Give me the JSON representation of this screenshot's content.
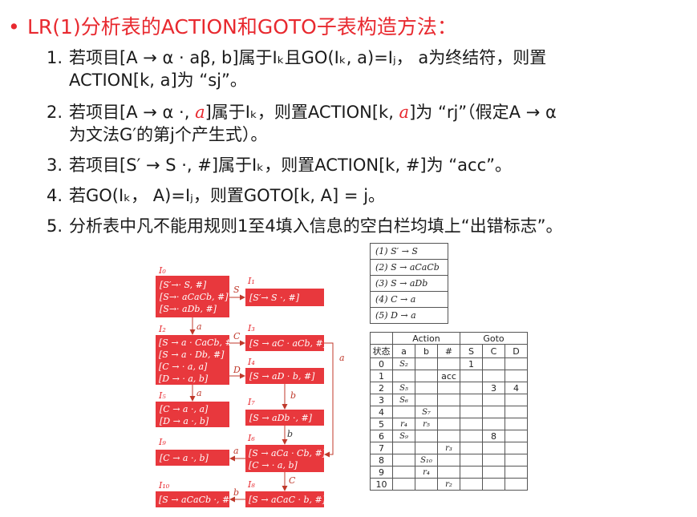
{
  "title": "LR(1)分析表的ACTION和GOTO子表构造方法：",
  "rules": [
    {
      "num": "1.",
      "text": "若项目[A → α · aβ, b]属于Iₖ且GO(Iₖ, a)=Iⱼ，  a为终结符，则置",
      "cont": "ACTION[k, a]为 “sj”。"
    },
    {
      "num": "2.",
      "pre": "若项目[A → α ·, ",
      "red1": "a",
      "mid": "]属于Iₖ，则置ACTION[k, ",
      "red2": "a",
      "post": "]为 “rj”（假定A → α",
      "cont": "为文法G′的第j个产生式）。"
    },
    {
      "num": "3.",
      "text": "若项目[S′ → S ·, #]属于Iₖ，则置ACTION[k, #]为 “acc”。"
    },
    {
      "num": "4.",
      "text": "若GO(Iₖ， A)=Iⱼ，则置GOTO[k, A] = j。"
    },
    {
      "num": "5.",
      "text": "分析表中凡不能用规则1至4填入信息的空白栏均填上“出错标志”。"
    }
  ],
  "states": [
    {
      "label": "I₀",
      "items": [
        "[S′→· S, #]",
        "[S→· aCaCb, #]",
        "[S→· aDb, #]"
      ]
    },
    {
      "label": "I₁",
      "items": [
        "[S′→ S ·, #]"
      ]
    },
    {
      "label": "I₂",
      "items": [
        "[S → a · CaCb, #]",
        "[S → a · Db, #]",
        "[C → · a, a]",
        "[D → · a, b]"
      ]
    },
    {
      "label": "I₃",
      "items": [
        "[S → aC · aCb, #]"
      ]
    },
    {
      "label": "I₄",
      "items": [
        "[S → aD · b, #]"
      ]
    },
    {
      "label": "I₅",
      "items": [
        "[C → a ·, a]",
        "[D → a ·, b]"
      ]
    },
    {
      "label": "I₇",
      "items": [
        "[S → aDb ·, #]"
      ]
    },
    {
      "label": "I₆",
      "items": [
        "[S → aCa · Cb, #]",
        "[C → · a, b]"
      ]
    },
    {
      "label": "I₉",
      "items": [
        "[C → a ·, b]"
      ]
    },
    {
      "label": "I₁₀",
      "items": [
        "[S → aCaCb ·, #]"
      ]
    },
    {
      "label": "I₈",
      "items": [
        "[S → aCaC · b, #]"
      ]
    }
  ],
  "edges": [
    "S",
    "a",
    "C",
    "D",
    "a",
    "b",
    "b",
    "a",
    "a",
    "C",
    "b"
  ],
  "grammar": [
    "(1) S′ → S",
    "(2) S → aCaCb",
    "(3) S → aDb",
    "(4) C → a",
    "(5) D → a"
  ],
  "table": {
    "action_label": "Action",
    "goto_label": "Goto",
    "headers": [
      "状态",
      "a",
      "b",
      "#",
      "S",
      "C",
      "D"
    ],
    "rows": [
      [
        "0",
        "S₂",
        "",
        "",
        "1",
        "",
        ""
      ],
      [
        "1",
        "",
        "",
        "acc",
        "",
        "",
        ""
      ],
      [
        "2",
        "S₅",
        "",
        "",
        "",
        "3",
        "4"
      ],
      [
        "3",
        "S₆",
        "",
        "",
        "",
        "",
        ""
      ],
      [
        "4",
        "",
        "S₇",
        "",
        "",
        "",
        ""
      ],
      [
        "5",
        "r₄",
        "r₅",
        "",
        "",
        "",
        ""
      ],
      [
        "6",
        "S₉",
        "",
        "",
        "",
        "8",
        ""
      ],
      [
        "7",
        "",
        "",
        "r₃",
        "",
        "",
        ""
      ],
      [
        "8",
        "",
        "S₁₀",
        "",
        "",
        "",
        ""
      ],
      [
        "9",
        "",
        "r₄",
        "",
        "",
        "",
        ""
      ],
      [
        "10",
        "",
        "",
        "r₂",
        "",
        "",
        ""
      ]
    ]
  },
  "colors": {
    "accent": "#e8292f",
    "box": "#e8383d",
    "edge": "#c0392b"
  }
}
